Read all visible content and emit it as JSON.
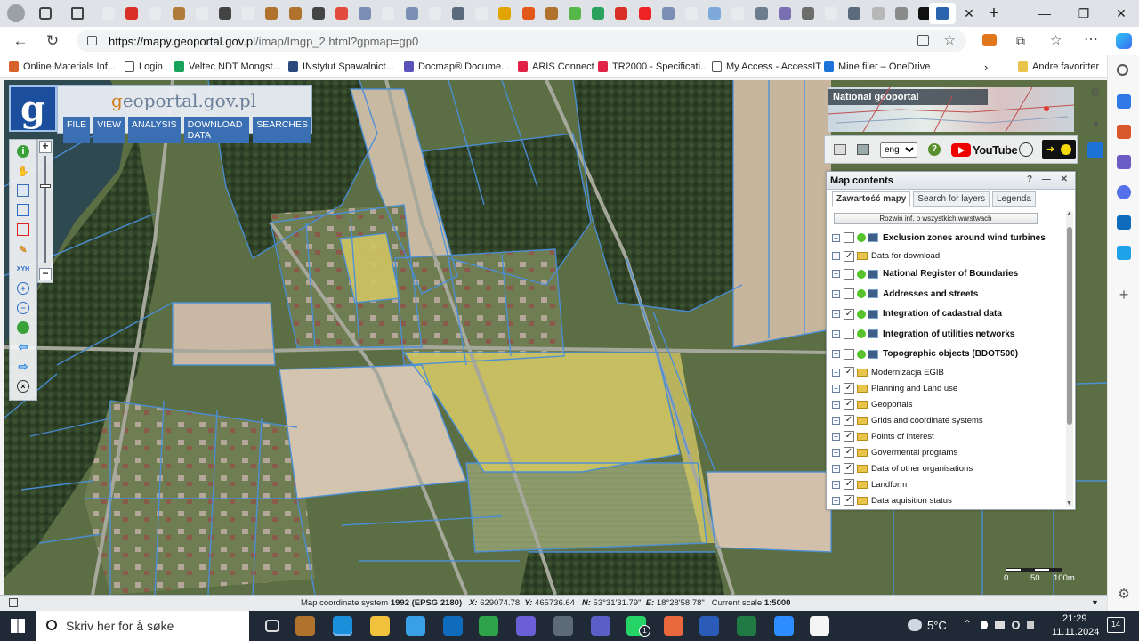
{
  "browser": {
    "tabs_count": 28,
    "active_tab_title": "",
    "new_tab_label": "+",
    "window_controls": {
      "minimize": "—",
      "restore": "❐",
      "close": "✕"
    },
    "address": {
      "host": "https://mapy.geoportal.gov.pl",
      "path": "/imap/Imgp_2.html?gpmap=gp0"
    },
    "bookmarks": [
      {
        "label": "Online Materials Inf...",
        "color": "#d4622a"
      },
      {
        "label": "Login",
        "color": "#ffffff"
      },
      {
        "label": "Veltec NDT Mongst...",
        "color": "#18a35b"
      },
      {
        "label": "INstytut Spawalnict...",
        "color": "#2c4b7c"
      },
      {
        "label": "Docmap® Docume...",
        "color": "#5a54b8"
      },
      {
        "label": "ARIS Connect",
        "color": "#e02346"
      },
      {
        "label": "TR2000 - Specificati...",
        "color": "#e02346"
      },
      {
        "label": "My Access - AccessIT",
        "color": "#ffffff"
      },
      {
        "label": "Mine filer – OneDrive",
        "color": "#1e73d8"
      }
    ],
    "bookmarks_more": "Andre favoritter"
  },
  "geoportal": {
    "brand_g": "g",
    "brand_rest": "eoportal.gov.pl",
    "menu": [
      "FILE",
      "VIEW",
      "ANALYSIS",
      "DOWNLOAD DATA",
      "SEARCHES"
    ],
    "national_geoportal": "National geoportal",
    "language": "eng",
    "youtube": "YouTube",
    "map_contents": {
      "title": "Map contents",
      "controls": "? — ✕",
      "tabs": [
        "Zawartość mapy",
        "Search for layers",
        "Legenda"
      ],
      "expand_all": "Rozwiń inf. o wszystkich warstwach",
      "layers": [
        {
          "label": "Exclusion zones around wind turbines",
          "checked": false,
          "type": "wms"
        },
        {
          "label": "Data for download",
          "checked": true,
          "type": "folder"
        },
        {
          "label": "National Register of Boundaries",
          "checked": false,
          "type": "wms"
        },
        {
          "label": "Addresses and streets",
          "checked": false,
          "type": "wms"
        },
        {
          "label": "Integration of cadastral data",
          "checked": true,
          "type": "wms"
        },
        {
          "label": "Integration of utilities networks",
          "checked": false,
          "type": "wms"
        },
        {
          "label": "Topographic objects (BDOT500)",
          "checked": false,
          "type": "wms"
        },
        {
          "label": "Modernizacja EGIB",
          "checked": true,
          "type": "folder"
        },
        {
          "label": "Planning and Land use",
          "checked": true,
          "type": "folder"
        },
        {
          "label": "Geoportals",
          "checked": true,
          "type": "folder"
        },
        {
          "label": "Grids and coordinate systems",
          "checked": true,
          "type": "folder"
        },
        {
          "label": "Points of interest",
          "checked": true,
          "type": "folder"
        },
        {
          "label": "Govermental programs",
          "checked": true,
          "type": "folder"
        },
        {
          "label": "Data of other organisations",
          "checked": true,
          "type": "folder"
        },
        {
          "label": "Landform",
          "checked": true,
          "type": "folder"
        },
        {
          "label": "Data aquisition status",
          "checked": true,
          "type": "folder"
        }
      ]
    },
    "scale_labels": [
      "0",
      "50",
      "100m"
    ],
    "status": {
      "system_label": "Map coordinate system",
      "system_value": "1992 (EPSG 2180)",
      "x_label": "X:",
      "x_value": "629074.78",
      "y_label": "Y:",
      "y_value": "465736.64",
      "n_label": "N:",
      "n_value": "53°31'31.79\"",
      "e_label": "E:",
      "e_value": "18°28'58.78\"",
      "scale_label": "Current scale",
      "scale_value": "1:5000"
    }
  },
  "taskbar": {
    "search_placeholder": "Skriv her for å søke",
    "weather": "5°C",
    "time": "21:29",
    "date": "11.11.2024",
    "notifications": "14",
    "whatsapp_badge": "1"
  }
}
